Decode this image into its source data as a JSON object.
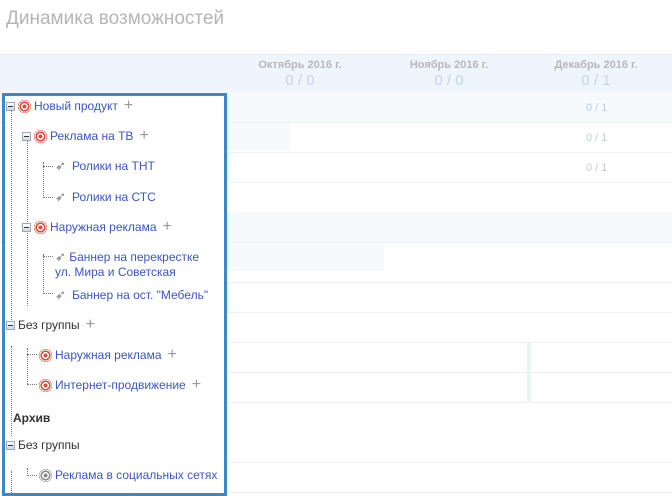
{
  "title": "Динамика возможностей",
  "months": [
    {
      "label": "Октябрь 2016 г.",
      "count": "0 / 0"
    },
    {
      "label": "Ноябрь 2016 г.",
      "count": "0 / 0"
    },
    {
      "label": "Декабрь 2016 г.",
      "count": "0 / 1"
    }
  ],
  "row_counts": [
    "0 / 1",
    "0 / 1",
    "0 / 1"
  ],
  "tree": {
    "n1": "Новый продукт",
    "n2": "Реклама на ТВ",
    "n3": "Ролики на ТНТ",
    "n4": "Ролики на СТС",
    "n5": "Наружная реклама",
    "n6a": "Баннер на перекрестке",
    "n6b": "ул. Мира и Советская",
    "n7": "Баннер на ост. \"Мебель\"",
    "n8": "Без группы",
    "n9": "Наружная реклама",
    "n10": "Интернет-продвижение",
    "archive": "Архив",
    "n11": "Без группы",
    "n12": "Реклама в социальных сетях"
  },
  "add_label": "+"
}
